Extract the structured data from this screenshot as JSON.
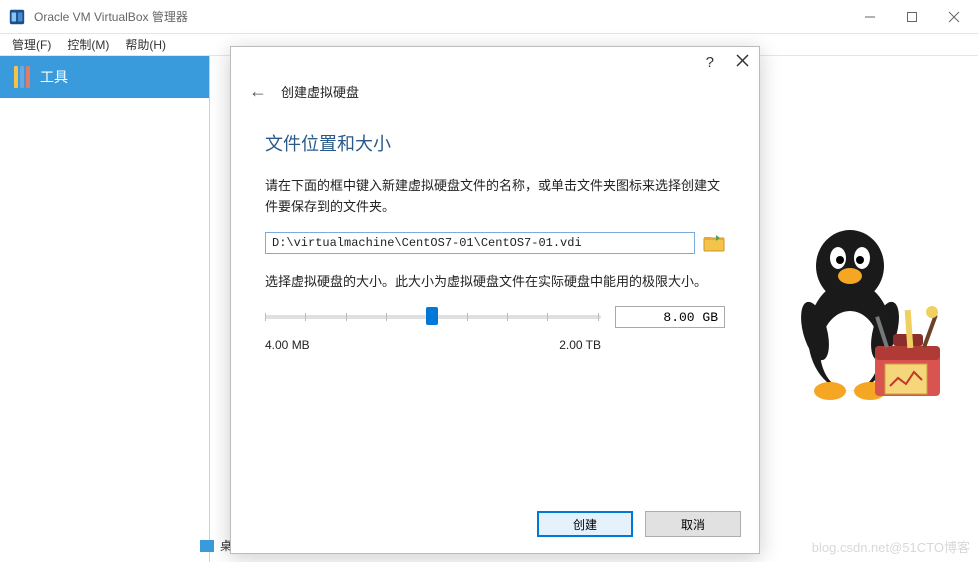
{
  "titlebar": {
    "text": "Oracle VM VirtualBox 管理器"
  },
  "menubar": {
    "manage": "管理(F)",
    "control": "控制(M)",
    "help": "帮助(H)"
  },
  "sidebar": {
    "tools_label": "工具"
  },
  "desktop_hint": "桌面",
  "watermark": "blog.csdn.net@51CTO博客",
  "dialog": {
    "title": "创建虚拟硬盘",
    "section_title": "文件位置和大小",
    "desc1": "请在下面的框中键入新建虚拟硬盘文件的名称，或单击文件夹图标来选择创建文件要保存到的文件夹。",
    "path_value": "D:\\virtualmachine\\CentOS7-01\\CentOS7-01.vdi",
    "desc2": "选择虚拟硬盘的大小。此大小为虚拟硬盘文件在实际硬盘中能用的极限大小。",
    "size_value": "8.00 GB",
    "slider_min": "4.00 MB",
    "slider_max": "2.00 TB",
    "create_label": "创建",
    "cancel_label": "取消"
  }
}
